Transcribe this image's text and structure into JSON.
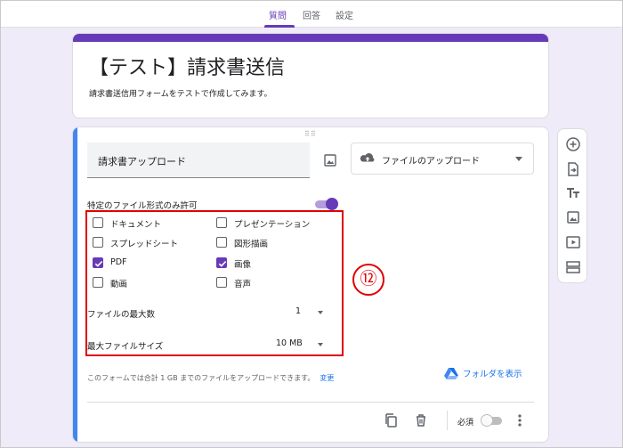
{
  "tabs": [
    {
      "label": "質問",
      "active": true
    },
    {
      "label": "回答",
      "active": false
    },
    {
      "label": "設定",
      "active": false
    }
  ],
  "form": {
    "title": "【テスト】請求書送信",
    "description": "請求書送信用フォームをテストで作成してみます。"
  },
  "question": {
    "title": "請求書アップロード",
    "type_label": "ファイルのアップロード",
    "type_icon": "cloud-upload-icon",
    "specific_types_label": "特定のファイル形式のみ許可",
    "specific_types_enabled": true,
    "file_types": [
      {
        "label": "ドキュメント",
        "checked": false
      },
      {
        "label": "プレゼンテーション",
        "checked": false
      },
      {
        "label": "スプレッドシート",
        "checked": false
      },
      {
        "label": "図形描画",
        "checked": false
      },
      {
        "label": "PDF",
        "checked": true
      },
      {
        "label": "画像",
        "checked": true
      },
      {
        "label": "動画",
        "checked": false
      },
      {
        "label": "音声",
        "checked": false
      }
    ],
    "max_files_label": "ファイルの最大数",
    "max_files_value": "1",
    "max_size_label": "最大ファイルサイズ",
    "max_size_value": "10 MB",
    "footnote": "このフォームでは合計 1 GB までのファイルをアップロードできます。",
    "footnote_link": "変更",
    "folder_link": "フォルダを表示",
    "required_label": "必須",
    "required": false
  },
  "annotation": {
    "marker": "⑫",
    "color": "#e00000"
  },
  "side_toolbar": [
    "add-question-icon",
    "import-questions-icon",
    "add-title-icon",
    "add-image-icon",
    "add-video-icon",
    "add-section-icon"
  ],
  "colors": {
    "accent": "#673ab7",
    "background": "#f0ebf8",
    "focus_bar": "#4285f4",
    "link": "#1a73e8"
  }
}
